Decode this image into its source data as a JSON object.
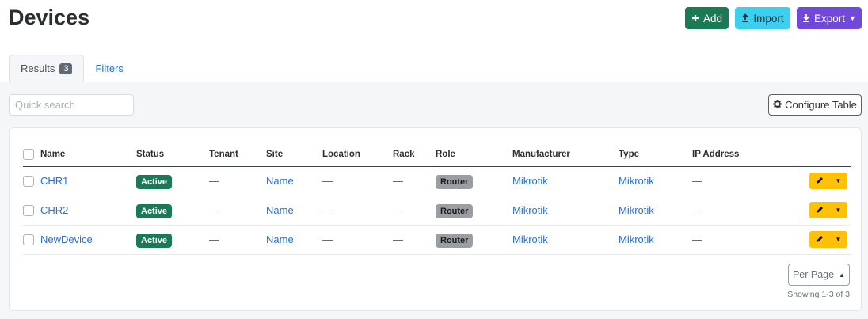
{
  "header": {
    "title": "Devices",
    "add_label": "Add",
    "import_label": "Import",
    "export_label": "Export"
  },
  "tabs": {
    "results_label": "Results",
    "results_count": "3",
    "filters_label": "Filters"
  },
  "search": {
    "placeholder": "Quick search"
  },
  "configure_label": "Configure Table",
  "table": {
    "columns": [
      "Name",
      "Status",
      "Tenant",
      "Site",
      "Location",
      "Rack",
      "Role",
      "Manufacturer",
      "Type",
      "IP Address"
    ],
    "rows": [
      {
        "name": "CHR1",
        "status": "Active",
        "tenant": "—",
        "site": "Name",
        "location": "—",
        "rack": "—",
        "role": "Router",
        "manufacturer": "Mikrotik",
        "type": "Mikrotik",
        "ip": "—"
      },
      {
        "name": "CHR2",
        "status": "Active",
        "tenant": "—",
        "site": "Name",
        "location": "—",
        "rack": "—",
        "role": "Router",
        "manufacturer": "Mikrotik",
        "type": "Mikrotik",
        "ip": "—"
      },
      {
        "name": "NewDevice",
        "status": "Active",
        "tenant": "—",
        "site": "Name",
        "location": "—",
        "rack": "—",
        "role": "Router",
        "manufacturer": "Mikrotik",
        "type": "Mikrotik",
        "ip": "—"
      }
    ]
  },
  "pagination": {
    "per_page_label": "Per Page",
    "showing": "Showing 1-3 of 3"
  },
  "colors": {
    "add": "#1a7a55",
    "import": "#3dd0ee",
    "export": "#7149d9",
    "status_active": "#1a7a55",
    "role": "#9a9ea3",
    "action": "#ffc107",
    "link": "#2c6fd1"
  }
}
